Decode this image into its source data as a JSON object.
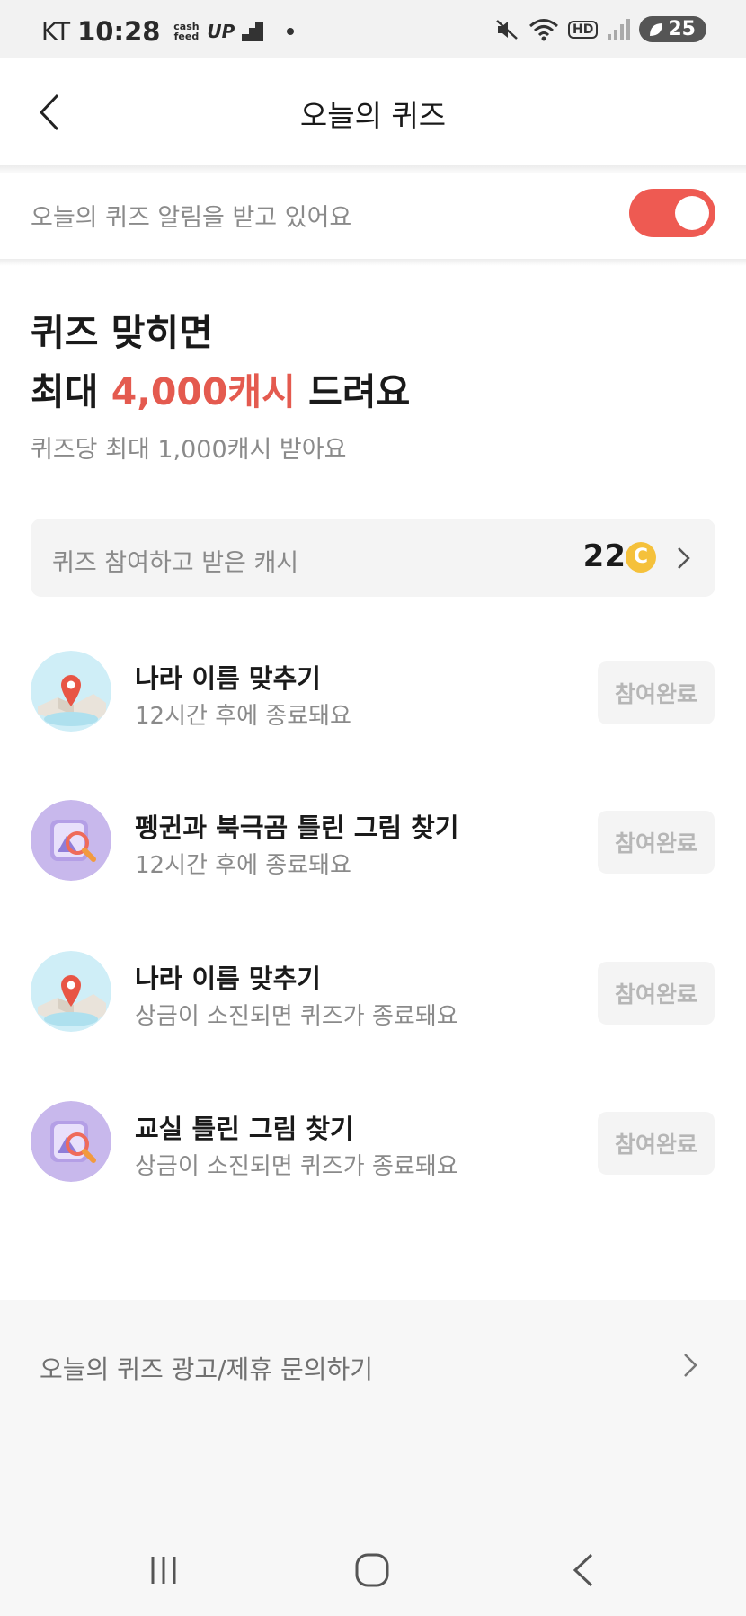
{
  "status_bar": {
    "carrier": "KT",
    "time": "10:28",
    "cashfeed": "cash feed",
    "up": "UP",
    "hd": "HD",
    "battery": "25"
  },
  "header": {
    "title": "오늘의 퀴즈"
  },
  "notify": {
    "text": "오늘의 퀴즈 알림을 받고 있어요",
    "toggle_on": true
  },
  "hero": {
    "line1": "퀴즈 맞히면",
    "line2_prefix": "최대 ",
    "line2_accent": "4,000캐시",
    "line2_suffix": " 드려요",
    "subtitle": "퀴즈당 최대 1,000캐시 받아요",
    "accent_color": "#e45a4f"
  },
  "earned": {
    "label": "퀴즈 참여하고 받은 캐시",
    "value": "22",
    "coin_symbol": "C"
  },
  "quizzes": [
    {
      "title": "나라 이름 맞추기",
      "subtitle": "12시간 후에 종료돼요",
      "button": "참여완료",
      "icon": "map-pin-icon"
    },
    {
      "title": "펭귄과 북극곰 틀린 그림 찾기",
      "subtitle": "12시간 후에 종료돼요",
      "button": "참여완료",
      "icon": "magnifier-picture-icon"
    },
    {
      "title": "나라 이름 맞추기",
      "subtitle": "상금이 소진되면 퀴즈가 종료돼요",
      "button": "참여완료",
      "icon": "map-pin-icon"
    },
    {
      "title": "교실 틀린 그림 찾기",
      "subtitle": "상금이 소진되면 퀴즈가 종료돼요",
      "button": "참여완료",
      "icon": "magnifier-picture-icon"
    }
  ],
  "footer": {
    "inquiry": "오늘의 퀴즈 광고/제휴 문의하기"
  }
}
